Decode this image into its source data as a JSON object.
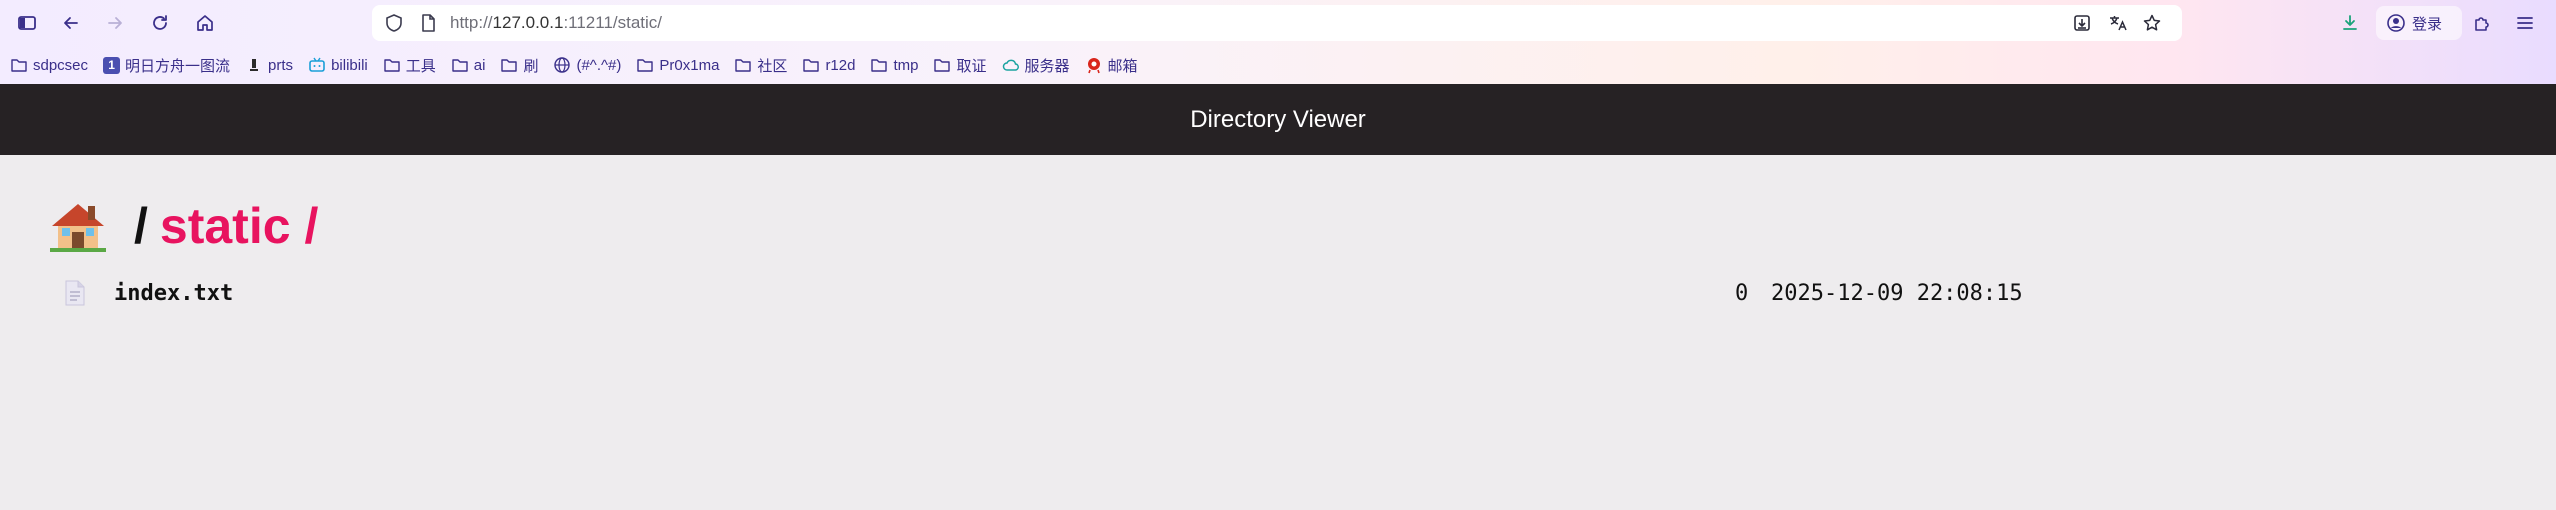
{
  "browser": {
    "url": {
      "prefix": "http://",
      "host": "127.0.0.1",
      "rest": ":11211/static/"
    },
    "login_label": "登录",
    "toolbar_icons": [
      "sidebar-icon",
      "back-icon",
      "forward-icon",
      "reload-icon",
      "home-icon",
      "shield-icon",
      "page-icon",
      "save-page-icon",
      "translate-icon",
      "star-icon",
      "download-icon",
      "account-icon",
      "extensions-icon",
      "menu-icon"
    ],
    "bookmarks": [
      {
        "label": "sdpcsec",
        "icon": "folder-icon"
      },
      {
        "label": "明日方舟一图流",
        "icon": "site-badge-icon",
        "badge": "1"
      },
      {
        "label": "prts",
        "icon": "site-icon"
      },
      {
        "label": "bilibili",
        "icon": "bilibili-icon"
      },
      {
        "label": "工具",
        "icon": "folder-icon"
      },
      {
        "label": "ai",
        "icon": "folder-icon"
      },
      {
        "label": "刷",
        "icon": "folder-icon"
      },
      {
        "label": "(#^.^#)",
        "icon": "globe-icon"
      },
      {
        "label": "Pr0x1ma",
        "icon": "folder-icon"
      },
      {
        "label": "社区",
        "icon": "folder-icon"
      },
      {
        "label": "r12d",
        "icon": "folder-icon"
      },
      {
        "label": "tmp",
        "icon": "folder-icon"
      },
      {
        "label": "取证",
        "icon": "folder-icon"
      },
      {
        "label": "服务器",
        "icon": "cloud-icon"
      },
      {
        "label": "邮箱",
        "icon": "mail-icon"
      }
    ]
  },
  "page": {
    "title": "Directory Viewer",
    "breadcrumb": {
      "separator": "/",
      "current": "static",
      "trailing": "/"
    },
    "files": [
      {
        "name": "index.txt",
        "size": "0",
        "modified": "2025-12-09 22:08:15",
        "icon": "file-icon"
      }
    ]
  },
  "colors": {
    "topbar_bg": "#262224",
    "page_bg": "#eeecee",
    "accent": "#e8135f",
    "bookmark_text": "#3a2f8a"
  }
}
